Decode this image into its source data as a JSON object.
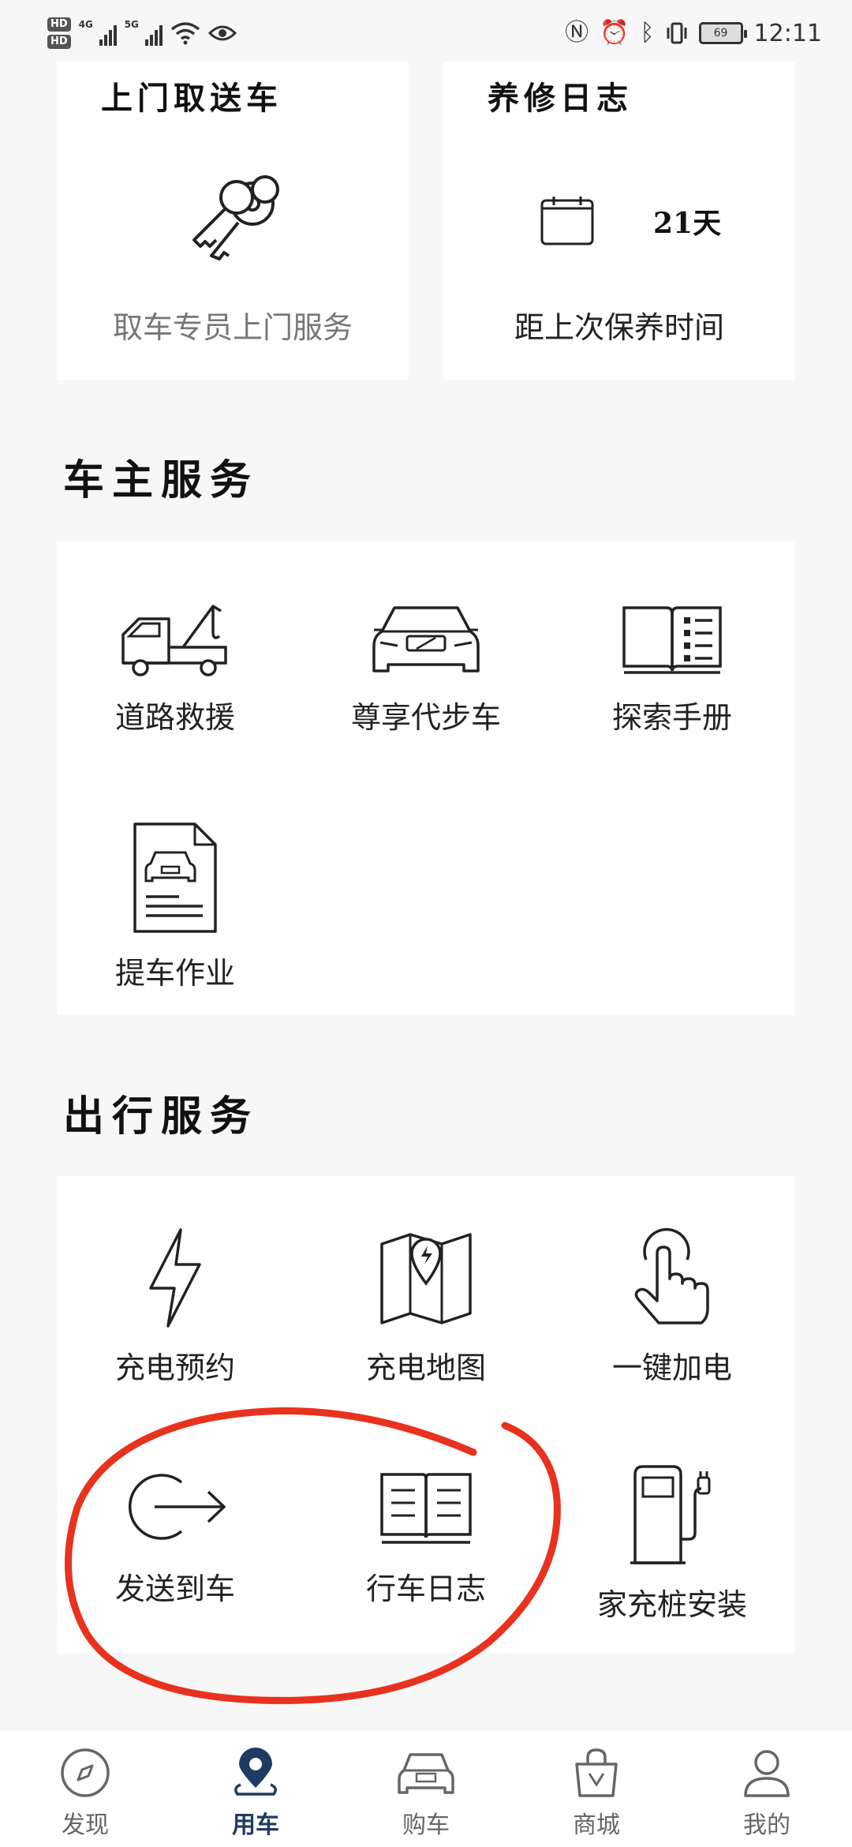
{
  "status_bar": {
    "hd_labels": [
      "HD",
      "HD"
    ],
    "net_1": "4G",
    "net_2": "5G",
    "battery": "69",
    "time": "12:11"
  },
  "top_cards": {
    "pickup": {
      "title": "上门取送车",
      "subtitle": "取车专员上门服务",
      "icon": "keys-icon"
    },
    "maintenance": {
      "title": "养修日志",
      "days": "21天",
      "subtitle": "距上次保养时间",
      "icon": "calendar-icon"
    }
  },
  "owner_services": {
    "title": "车主服务",
    "items": [
      {
        "label": "道路救援",
        "icon": "tow-truck-icon"
      },
      {
        "label": "尊享代步车",
        "icon": "car-front-icon"
      },
      {
        "label": "探索手册",
        "icon": "manual-book-icon"
      },
      {
        "label": "提车作业",
        "icon": "delivery-document-icon"
      }
    ]
  },
  "travel_services": {
    "title": "出行服务",
    "items": [
      {
        "label": "充电预约",
        "icon": "lightning-icon"
      },
      {
        "label": "充电地图",
        "icon": "charging-map-icon"
      },
      {
        "label": "一键加电",
        "icon": "tap-finger-icon"
      },
      {
        "label": "发送到车",
        "icon": "send-to-car-icon"
      },
      {
        "label": "行车日志",
        "icon": "driving-log-icon"
      },
      {
        "label": "家充桩安装",
        "icon": "charging-pile-icon"
      }
    ]
  },
  "tab_bar": {
    "tabs": [
      {
        "label": "发现",
        "icon": "compass-icon",
        "active": false
      },
      {
        "label": "用车",
        "icon": "location-pin-icon",
        "active": true
      },
      {
        "label": "购车",
        "icon": "car-icon",
        "active": false
      },
      {
        "label": "商城",
        "icon": "shopping-bag-icon",
        "active": false
      },
      {
        "label": "我的",
        "icon": "profile-icon",
        "active": false
      }
    ]
  },
  "colors": {
    "background": "#f7f7f7",
    "card": "#ffffff",
    "active_tab": "#1f3b62",
    "annotation": "#e8321e"
  }
}
